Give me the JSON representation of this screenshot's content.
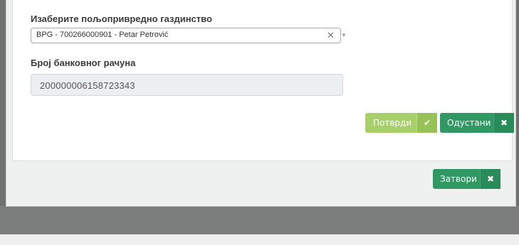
{
  "form": {
    "holding_label": "Изаберите пољопривредно газдинство",
    "holding_value": "BPG - 700266000901 - Petar Petrović",
    "account_label": "Број банковног рачуна",
    "account_value": "200000006158723343"
  },
  "actions": {
    "confirm_label": "Потврди",
    "cancel_label": "Одустани",
    "close_label": "Затвори"
  },
  "icons": {
    "confirm": "check-icon",
    "cancel": "times-icon",
    "close": "times-icon",
    "select_clear": "times-icon",
    "select_toggle": "caret-down-icon"
  },
  "colors": {
    "confirm": "#a7cf6a",
    "cancel": "#2f9863",
    "close": "#2f9863"
  }
}
